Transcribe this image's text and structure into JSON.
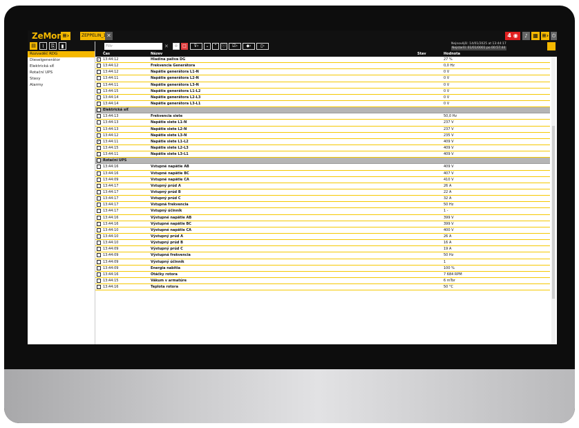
{
  "app": {
    "logo": "ZeMon",
    "tab_label": "ZEPPELIN_1",
    "alarm_count": "4"
  },
  "sidebar": {
    "items": [
      {
        "label": "Rozvaděč RDG",
        "active": true
      },
      {
        "label": "Dieselgenerátor",
        "active": false
      },
      {
        "label": "Elektrická síť",
        "active": false
      },
      {
        "label": "Rotační UPS",
        "active": false
      },
      {
        "label": "Stavy",
        "active": false
      },
      {
        "label": "Alarmy",
        "active": false
      }
    ]
  },
  "filter": {
    "placeholder": "Filtr",
    "newest": "Nejnovější: 14/01/2025 at 13:44:17",
    "oldest": "Nejstarší: 01/01/0001 po 00:57:44"
  },
  "table": {
    "headers": {
      "time": "Čas",
      "name": "Název",
      "state": "Stav",
      "value": "Hodnota"
    },
    "rows": [
      {
        "type": "data",
        "checked": true,
        "time": "13:44:12",
        "name": "Hladina paliva DG",
        "value": "27 %"
      },
      {
        "type": "data",
        "checked": false,
        "time": "13:44:12",
        "name": "Frekvencia Generátora",
        "value": "0,0 Hz"
      },
      {
        "type": "data",
        "checked": false,
        "time": "13:44:12",
        "name": "Napätie generátora L1-N",
        "value": "0 V"
      },
      {
        "type": "data",
        "checked": false,
        "time": "13:44:11",
        "name": "Napätie generátora L2-N",
        "value": "0 V"
      },
      {
        "type": "data",
        "checked": false,
        "time": "13:44:11",
        "name": "Napätie generátora L3-N",
        "value": "0 V"
      },
      {
        "type": "data",
        "checked": false,
        "time": "13:44:15",
        "name": "Napätie generátora L1-L2",
        "value": "0 V"
      },
      {
        "type": "data",
        "checked": false,
        "time": "13:44:14",
        "name": "Napätie generátora L2-L3",
        "value": "0 V"
      },
      {
        "type": "data",
        "checked": false,
        "time": "13:44:14",
        "name": "Napätie generátora L3-L1",
        "value": "0 V"
      },
      {
        "type": "group",
        "label": "Elektrická síť"
      },
      {
        "type": "data",
        "checked": false,
        "time": "13:44:13",
        "name": "Frekvencia siete",
        "value": "50,0 Hz"
      },
      {
        "type": "data",
        "checked": false,
        "time": "13:44:13",
        "name": "Napätie siete L1-N",
        "value": "237 V"
      },
      {
        "type": "data",
        "checked": false,
        "time": "13:44:13",
        "name": "Napätie siete L2-N",
        "value": "237 V"
      },
      {
        "type": "data",
        "checked": false,
        "time": "13:44:12",
        "name": "Napätie siete L3-N",
        "value": "235 V"
      },
      {
        "type": "data",
        "checked": true,
        "time": "13:44:11",
        "name": "Napätie siete L1-L2",
        "value": "409 V"
      },
      {
        "type": "data",
        "checked": false,
        "time": "13:44:15",
        "name": "Napätie siete L2-L3",
        "value": "409 V"
      },
      {
        "type": "data",
        "checked": false,
        "time": "13:44:11",
        "name": "Napätie siete L3-L1",
        "value": "409 V"
      },
      {
        "type": "group",
        "label": "Rotační UPS"
      },
      {
        "type": "data",
        "checked": false,
        "time": "13:44:16",
        "name": "Vstupné napätie AB",
        "value": "409 V"
      },
      {
        "type": "data",
        "checked": false,
        "time": "13:44:16",
        "name": "Vstupné napätie BC",
        "value": "407 V"
      },
      {
        "type": "data",
        "checked": false,
        "time": "13:44:09",
        "name": "Vstupné napätie CA",
        "value": "410 V"
      },
      {
        "type": "data",
        "checked": false,
        "time": "13:44:17",
        "name": "Vstupný prúd A",
        "value": "26 A"
      },
      {
        "type": "data",
        "checked": false,
        "time": "13:44:17",
        "name": "Vstupný prúd B",
        "value": "22 A"
      },
      {
        "type": "data",
        "checked": false,
        "time": "13:44:17",
        "name": "Vstupný prúd C",
        "value": "32 A"
      },
      {
        "type": "data",
        "checked": false,
        "time": "13:44:17",
        "name": "Vstupná frekvencia",
        "value": "50 Hz"
      },
      {
        "type": "data",
        "checked": false,
        "time": "13:44:17",
        "name": "Vstupný účinník",
        "value": "1 -"
      },
      {
        "type": "data",
        "checked": false,
        "time": "13:44:16",
        "name": "Výstupné napätie AB",
        "value": "399 V"
      },
      {
        "type": "data",
        "checked": false,
        "time": "13:44:16",
        "name": "Výstupné napätie BC",
        "value": "399 V"
      },
      {
        "type": "data",
        "checked": false,
        "time": "13:44:10",
        "name": "Výstupné napätie CA",
        "value": "400 V"
      },
      {
        "type": "data",
        "checked": false,
        "time": "13:44:10",
        "name": "Výstupný prúd A",
        "value": "26 A"
      },
      {
        "type": "data",
        "checked": false,
        "time": "13:44:10",
        "name": "Výstupný prúd B",
        "value": "16 A"
      },
      {
        "type": "data",
        "checked": false,
        "time": "13:44:09",
        "name": "Výstupný prúd C",
        "value": "19 A"
      },
      {
        "type": "data",
        "checked": false,
        "time": "13:44:09",
        "name": "Výstupná frekvencia",
        "value": "50 Hz"
      },
      {
        "type": "data",
        "checked": false,
        "time": "13:44:09",
        "name": "Výstupný účinník",
        "value": "1"
      },
      {
        "type": "data",
        "checked": false,
        "time": "13:44:09",
        "name": "Energia nabitia",
        "value": "100 %"
      },
      {
        "type": "data",
        "checked": false,
        "time": "13:44:16",
        "name": "Otáčky rotora",
        "value": "7 684 RPM"
      },
      {
        "type": "data",
        "checked": false,
        "time": "13:44:15",
        "name": "Vákum v armatúre",
        "value": "6 mTor"
      },
      {
        "type": "data",
        "checked": false,
        "time": "13:44:16",
        "name": "Teplota rotora",
        "value": "50 °C"
      }
    ]
  },
  "colors": {
    "accent": "#f5b800",
    "alarm": "#e02020",
    "row_border": "#f5c800",
    "group_bg": "#b5b5b5"
  }
}
